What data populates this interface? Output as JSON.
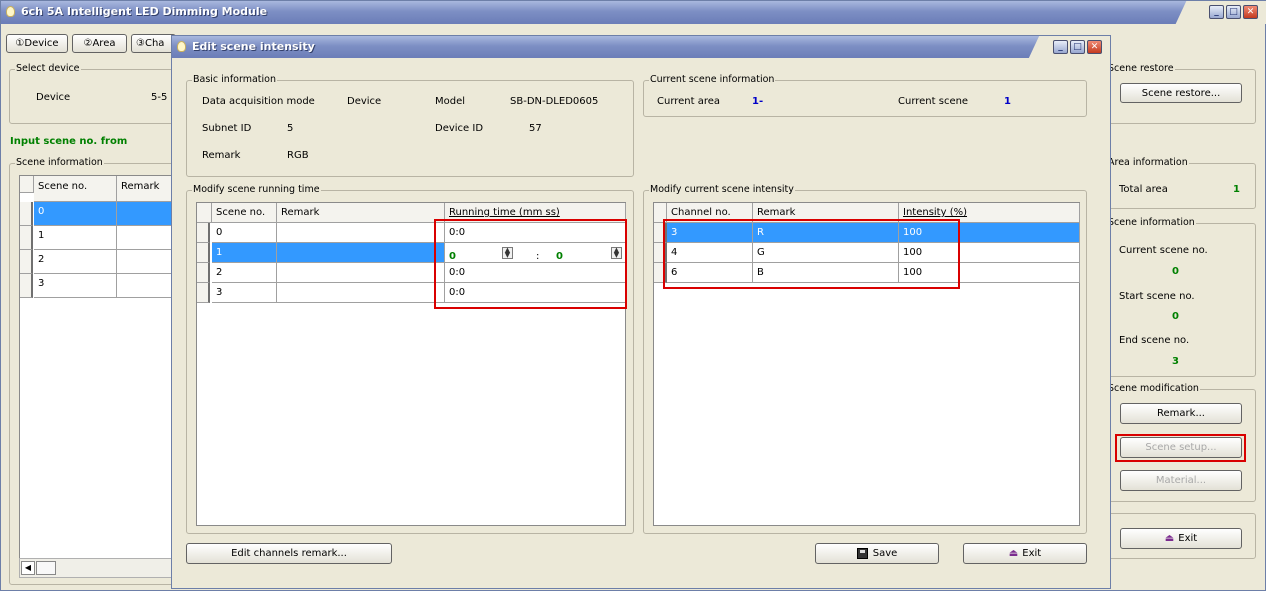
{
  "main": {
    "title": "6ch 5A Intelligent LED Dimming Module",
    "tabs": [
      "①Device",
      "②Area",
      "③Cha"
    ],
    "select_device": {
      "label": "Select device",
      "device_label": "Device",
      "device_value": "5-5"
    },
    "input_scene_label": "Input scene no. from",
    "scene_info": {
      "label": "Scene information",
      "col_scene": "Scene no.",
      "col_remark": "Remark",
      "rows": [
        "0",
        "1",
        "2",
        "3"
      ]
    },
    "scene_restore": {
      "label": "Scene restore",
      "button": "Scene restore..."
    },
    "area_info": {
      "label": "Area information",
      "total_area_label": "Total area",
      "total_area_value": "1"
    },
    "right_scene_info": {
      "label": "Scene information",
      "current_label": "Current scene no.",
      "current_value": "0",
      "start_label": "Start scene no.",
      "start_value": "0",
      "end_label": "End scene no.",
      "end_value": "3"
    },
    "scene_mod": {
      "label": "Scene modification",
      "remark_btn": "Remark...",
      "setup_btn": "Scene setup...",
      "material_btn": "Material..."
    },
    "exit_btn": "Exit"
  },
  "dialog": {
    "title": "Edit scene intensity",
    "basic": {
      "label": "Basic information",
      "daq_label": "Data acquisition mode",
      "daq_value": "Device",
      "model_label": "Model",
      "model_value": "SB-DN-DLED0605",
      "subnet_label": "Subnet ID",
      "subnet_value": "5",
      "devid_label": "Device ID",
      "devid_value": "57",
      "remark_label": "Remark",
      "remark_value": "RGB"
    },
    "current": {
      "label": "Current scene information",
      "area_label": "Current area",
      "area_value": "1-",
      "scene_label": "Current scene",
      "scene_value": "1"
    },
    "runtime": {
      "label": "Modify scene running time",
      "headers": [
        "Scene no.",
        "Remark",
        "Running time (mm ss)"
      ],
      "rows": [
        {
          "scene": "0",
          "remark": "",
          "time": "0:0"
        },
        {
          "scene": "1",
          "remark": "",
          "time": ""
        },
        {
          "scene": "2",
          "remark": "",
          "time": "0:0"
        },
        {
          "scene": "3",
          "remark": "",
          "time": "0:0"
        }
      ],
      "editor": {
        "mm": "0",
        "sep": ":",
        "ss": "0"
      }
    },
    "intensity": {
      "label": "Modify current scene intensity",
      "headers": [
        "Channel no.",
        "Remark",
        "Intensity (%)"
      ],
      "rows": [
        {
          "ch": "3",
          "remark": "R",
          "val": "100"
        },
        {
          "ch": "4",
          "remark": "G",
          "val": "100"
        },
        {
          "ch": "6",
          "remark": "B",
          "val": "100"
        }
      ]
    },
    "edit_channels_btn": "Edit channels remark...",
    "save_btn": "Save",
    "exit_btn": "Exit"
  }
}
